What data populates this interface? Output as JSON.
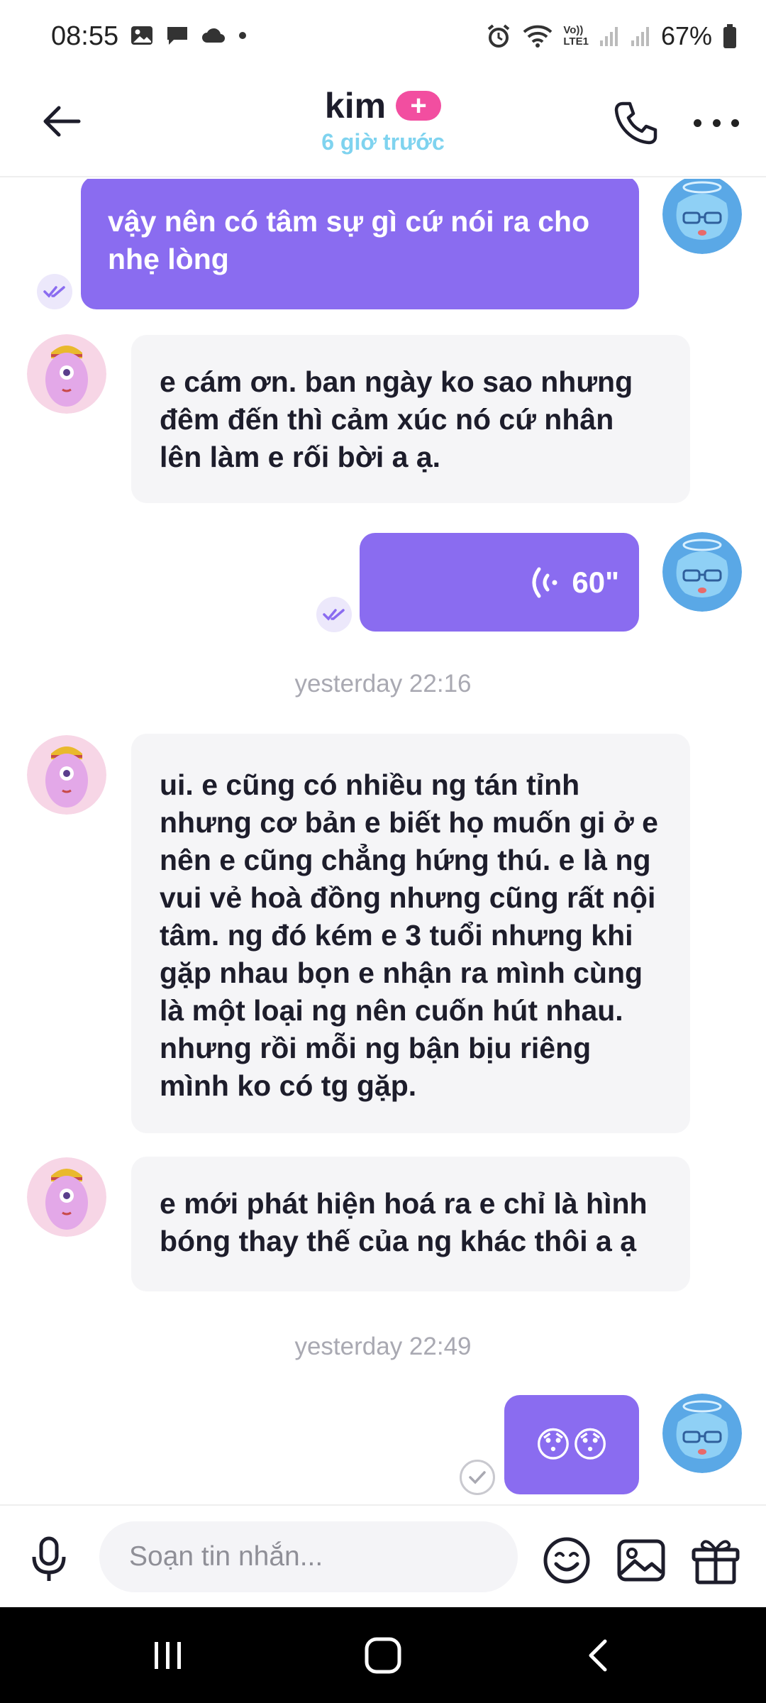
{
  "status_bar": {
    "time": "08:55",
    "battery": "67%",
    "icons_left": [
      "gallery-icon",
      "message-icon",
      "cloud-icon",
      "dot-icon"
    ],
    "icons_right": [
      "alarm-icon",
      "wifi-icon",
      "volte-icon",
      "signal-icon",
      "signal-icon",
      "battery-icon"
    ],
    "volte_label_top": "Vo))",
    "volte_label_bottom": "LTE1"
  },
  "header": {
    "name": "kim",
    "badge": "+",
    "last_seen": "6 giờ trước"
  },
  "messages": [
    {
      "side": "me",
      "text": "vậy nên có tâm sự gì cứ nói ra cho nhẹ lòng",
      "status": "read"
    },
    {
      "side": "them",
      "text": "e cám ơn. ban ngày ko sao nhưng đêm đến thì cảm xúc nó cứ nhân lên làm e rối bời a ạ."
    },
    {
      "side": "me",
      "type": "voice",
      "duration": "60\"",
      "status": "read"
    },
    {
      "side": "them",
      "text": "ui. e cũng có nhiều ng tán tỉnh nhưng cơ bản e biết họ muốn gi ở e nên e cũng chẳng hứng thú. e là ng vui vẻ hoà đồng nhưng cũng rất nội tâm. ng đó kém e 3 tuổi nhưng khi gặp nhau bọn e nhận ra mình cùng là một loại ng nên cuốn hút nhau. nhưng rồi mỗi ng bận bịu riêng mình ko có tg gặp."
    },
    {
      "side": "them",
      "text": "e mới phát hiện hoá ra e chỉ là hình bóng thay thế của ng khác thôi a ạ"
    },
    {
      "side": "me",
      "text": "😯😯",
      "status": "sent"
    }
  ],
  "timestamps": [
    "yesterday 22:16",
    "yesterday 22:49"
  ],
  "composer": {
    "placeholder": "Soạn tin nhắn..."
  },
  "colors": {
    "my_bubble": "#8a6cf0",
    "their_bubble": "#f5f5f7",
    "badge": "#f24ea0",
    "last_seen": "#7fd3ef"
  }
}
